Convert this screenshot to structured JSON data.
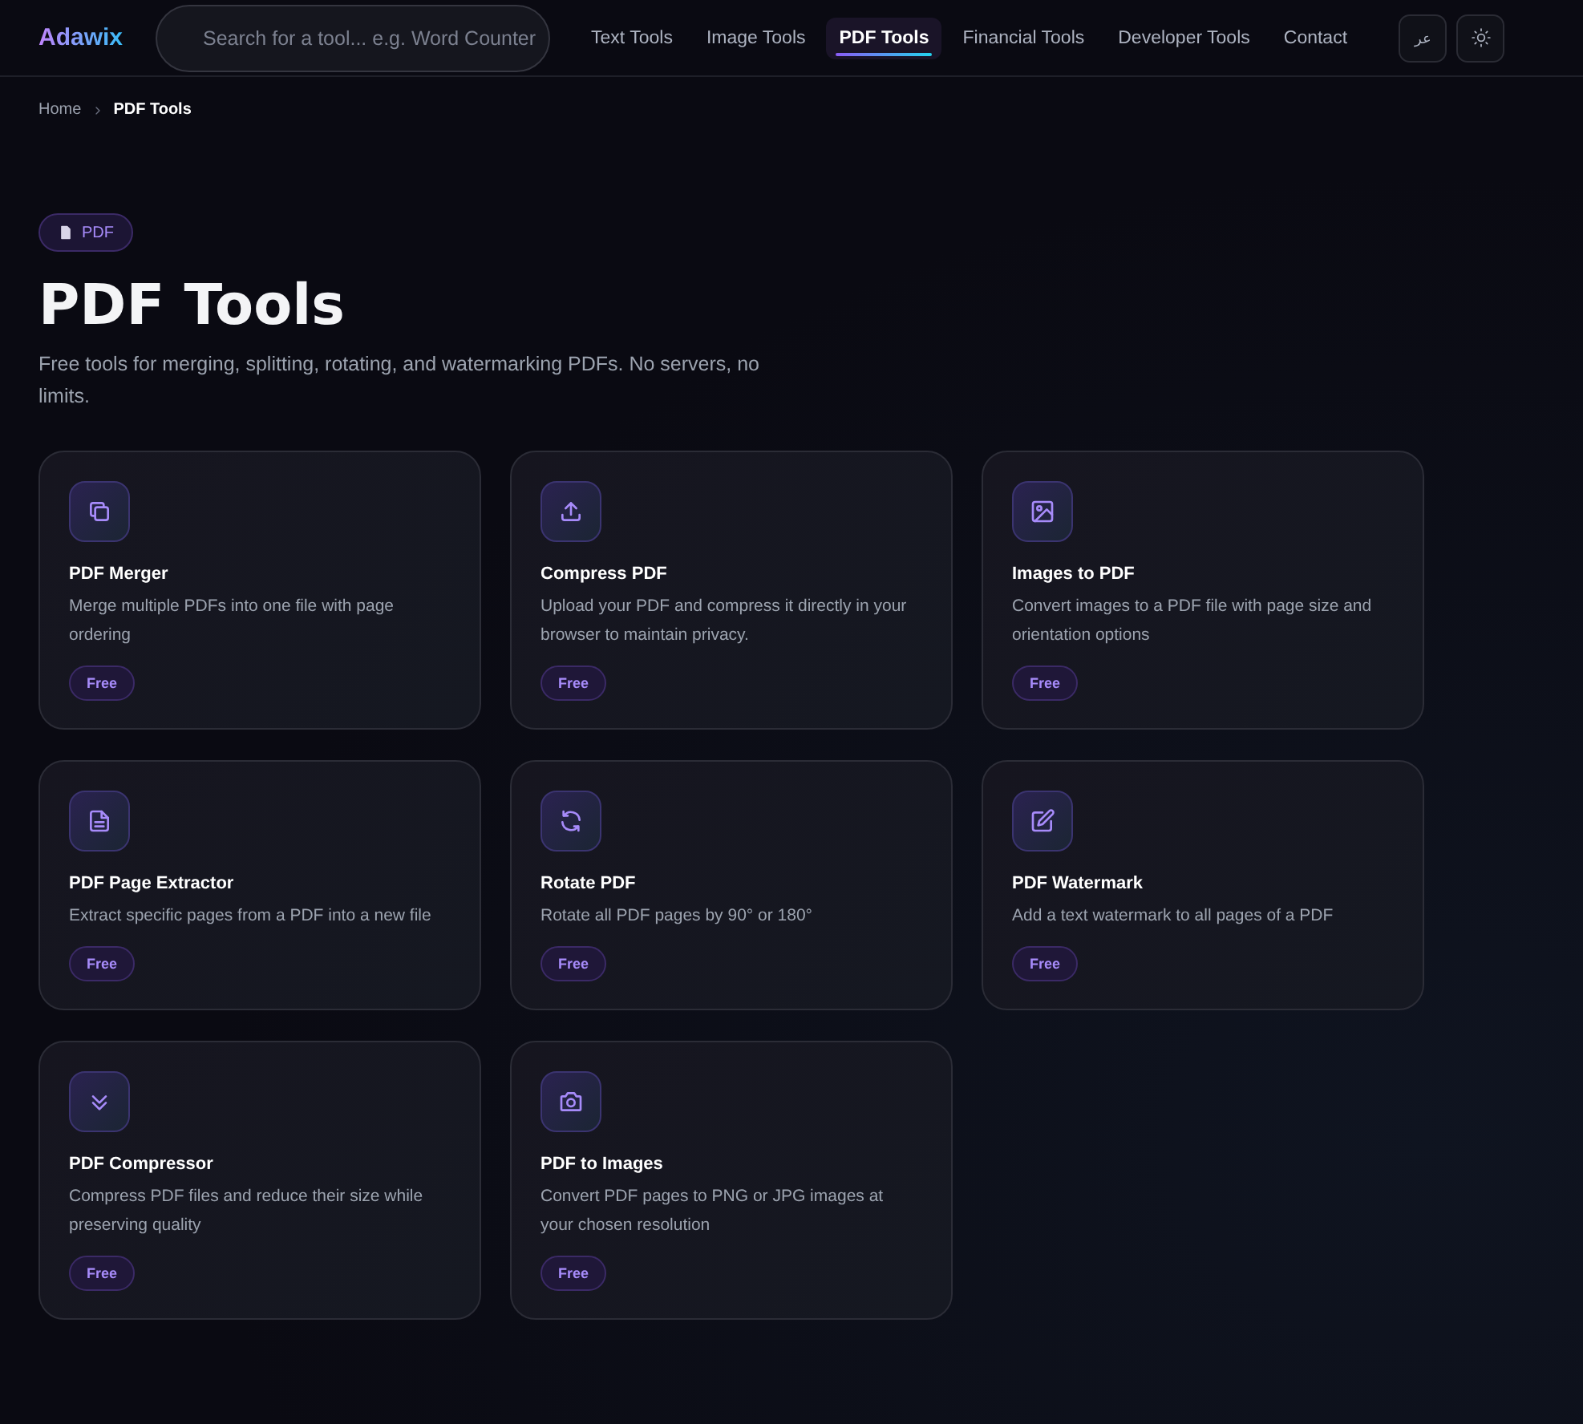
{
  "header": {
    "logo": "Adawix",
    "search": {
      "placeholder": "Search for a tool... e.g. Word Counter"
    },
    "nav": [
      {
        "label": "Text Tools",
        "selected": false
      },
      {
        "label": "Image Tools",
        "selected": false
      },
      {
        "label": "PDF Tools",
        "selected": true
      },
      {
        "label": "Financial Tools",
        "selected": false
      },
      {
        "label": "Developer Tools",
        "selected": false
      },
      {
        "label": "Contact",
        "selected": false
      }
    ],
    "language_button": "عر"
  },
  "breadcrumb": [
    {
      "label": "Home",
      "current": false
    },
    {
      "label": "PDF Tools",
      "current": true
    }
  ],
  "category_badge": "PDF",
  "title": "PDF Tools",
  "subtitle": "Free tools for merging, splitting, rotating, and watermarking PDFs. No servers, no limits.",
  "tools": [
    {
      "name": "PDF Merger",
      "description": "Merge multiple PDFs into one file with page ordering",
      "tag": "Free"
    },
    {
      "name": "Compress PDF",
      "description": "Upload your PDF and compress it directly in your browser to maintain privacy.",
      "tag": "Free"
    },
    {
      "name": "Images to PDF",
      "description": "Convert images to a PDF file with page size and orientation options",
      "tag": "Free"
    },
    {
      "name": "PDF Page Extractor",
      "description": "Extract specific pages from a PDF into a new file",
      "tag": "Free"
    },
    {
      "name": "Rotate PDF",
      "description": "Rotate all PDF pages by 90° or 180°",
      "tag": "Free"
    },
    {
      "name": "PDF Watermark",
      "description": "Add a text watermark to all pages of a PDF",
      "tag": "Free"
    },
    {
      "name": "PDF Compressor",
      "description": "Compress PDF files and reduce their size while preserving quality",
      "tag": "Free"
    },
    {
      "name": "PDF to Images",
      "description": "Convert PDF pages to PNG or JPG images at your chosen resolution",
      "tag": "Free"
    }
  ]
}
